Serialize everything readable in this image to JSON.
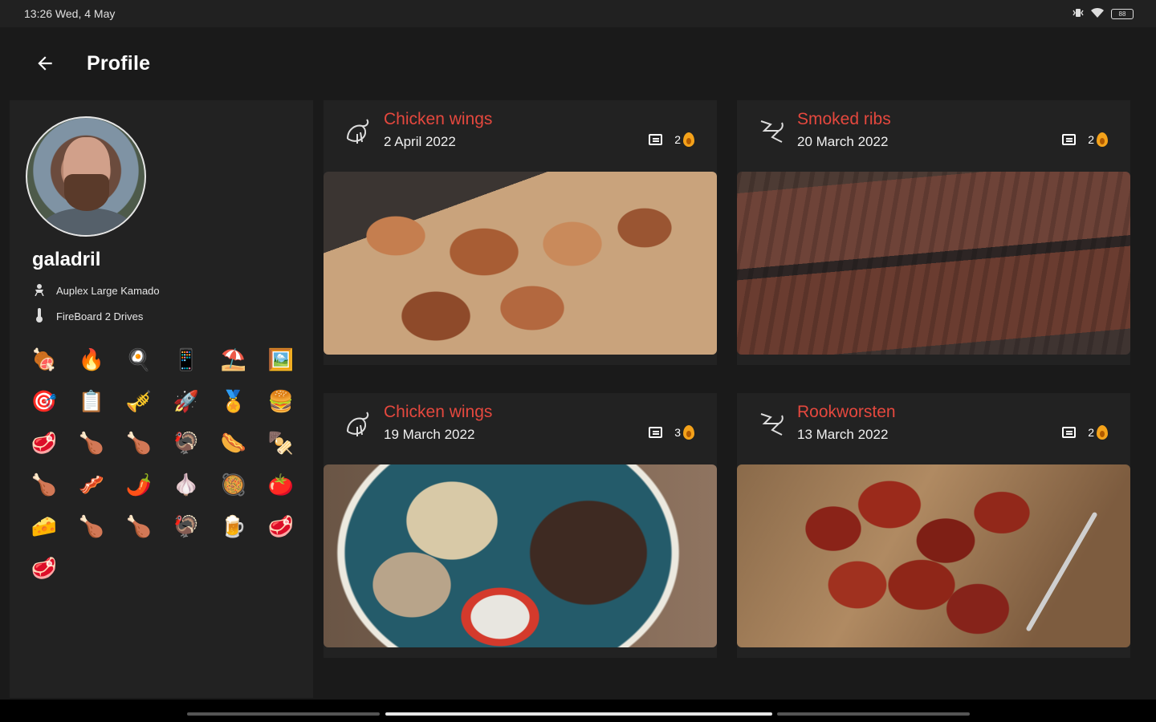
{
  "status_bar": {
    "time_date": "13:26 Wed, 4 May",
    "icons": [
      "vibrate-icon",
      "wifi-icon",
      "battery-icon"
    ],
    "battery_level": "88"
  },
  "app_bar": {
    "back_icon": "arrow-left-icon",
    "title": "Profile"
  },
  "profile": {
    "username": "galadril",
    "equipment": [
      {
        "icon": "grill-icon",
        "label": "Auplex Large Kamado"
      },
      {
        "icon": "thermometer-icon",
        "label": "FireBoard 2 Drives"
      }
    ],
    "badges": [
      "🍖",
      "🔥",
      "🍳",
      "📱",
      "⛱️",
      "🖼️",
      "🎯",
      "📋",
      "🎺",
      "🚀",
      "🏅",
      "🍔",
      "🥩",
      "🍗",
      "🍗",
      "🦃",
      "🌭",
      "🍢",
      "🍗",
      "🥓",
      "🌶️",
      "🧄",
      "🥘",
      "🍅",
      "🧀",
      "🍗",
      "🍗",
      "🦃",
      "🍺",
      "🥩",
      "🥩"
    ]
  },
  "posts": [
    {
      "title": "Chicken wings",
      "date": "2 April 2022",
      "comments": "2",
      "category_icon": "chicken-icon"
    },
    {
      "title": "Smoked ribs",
      "date": "20 March 2022",
      "comments": "2",
      "category_icon": "pig-icon"
    },
    {
      "title": "Chicken wings",
      "date": "19 March 2022",
      "comments": "3",
      "category_icon": "chicken-icon"
    },
    {
      "title": "Rookworsten",
      "date": "13 March 2022",
      "comments": "2",
      "category_icon": "pig-icon"
    }
  ],
  "colors": {
    "accent": "#e5483e",
    "background": "#1a1a1a",
    "card": "#222222",
    "flame": "#f4a21a"
  }
}
